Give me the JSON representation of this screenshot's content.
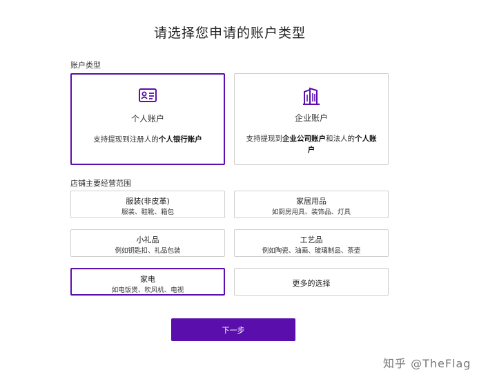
{
  "page_title": "请选择您申请的账户类型",
  "account_section": {
    "label": "账户类型",
    "cards": [
      {
        "name": "个人账户",
        "desc_prefix": "支持提现到注册人的",
        "desc_bold": "个人银行账户",
        "desc_mid": "",
        "desc_bold2": "",
        "icon": "id-card-icon",
        "selected": true
      },
      {
        "name": "企业账户",
        "desc_prefix": "支持提现到",
        "desc_bold": "企业公司账户",
        "desc_mid": "和法人的",
        "desc_bold2": "个人账户",
        "icon": "building-icon",
        "selected": false
      }
    ]
  },
  "scope_section": {
    "label": "店铺主要经营范围",
    "items": [
      {
        "name": "服装(非皮革)",
        "sub": "服装、鞋靴、箱包",
        "selected": false
      },
      {
        "name": "家居用品",
        "sub": "如厨房用具、装饰品、灯具",
        "selected": false
      },
      {
        "name": "小礼品",
        "sub": "例如钥匙扣、礼品包装",
        "selected": false
      },
      {
        "name": "工艺品",
        "sub": "例如陶瓷、油画、玻璃制品、茶壶",
        "selected": false
      },
      {
        "name": "家电",
        "sub": "如电饭煲、吹风机、电视",
        "selected": true
      },
      {
        "name": "更多的选择",
        "sub": "",
        "selected": false
      }
    ]
  },
  "next_button": "下一步",
  "watermark": "知乎 @TheFlag",
  "colors": {
    "accent": "#5a0eab",
    "border": "#cfcfcf"
  }
}
